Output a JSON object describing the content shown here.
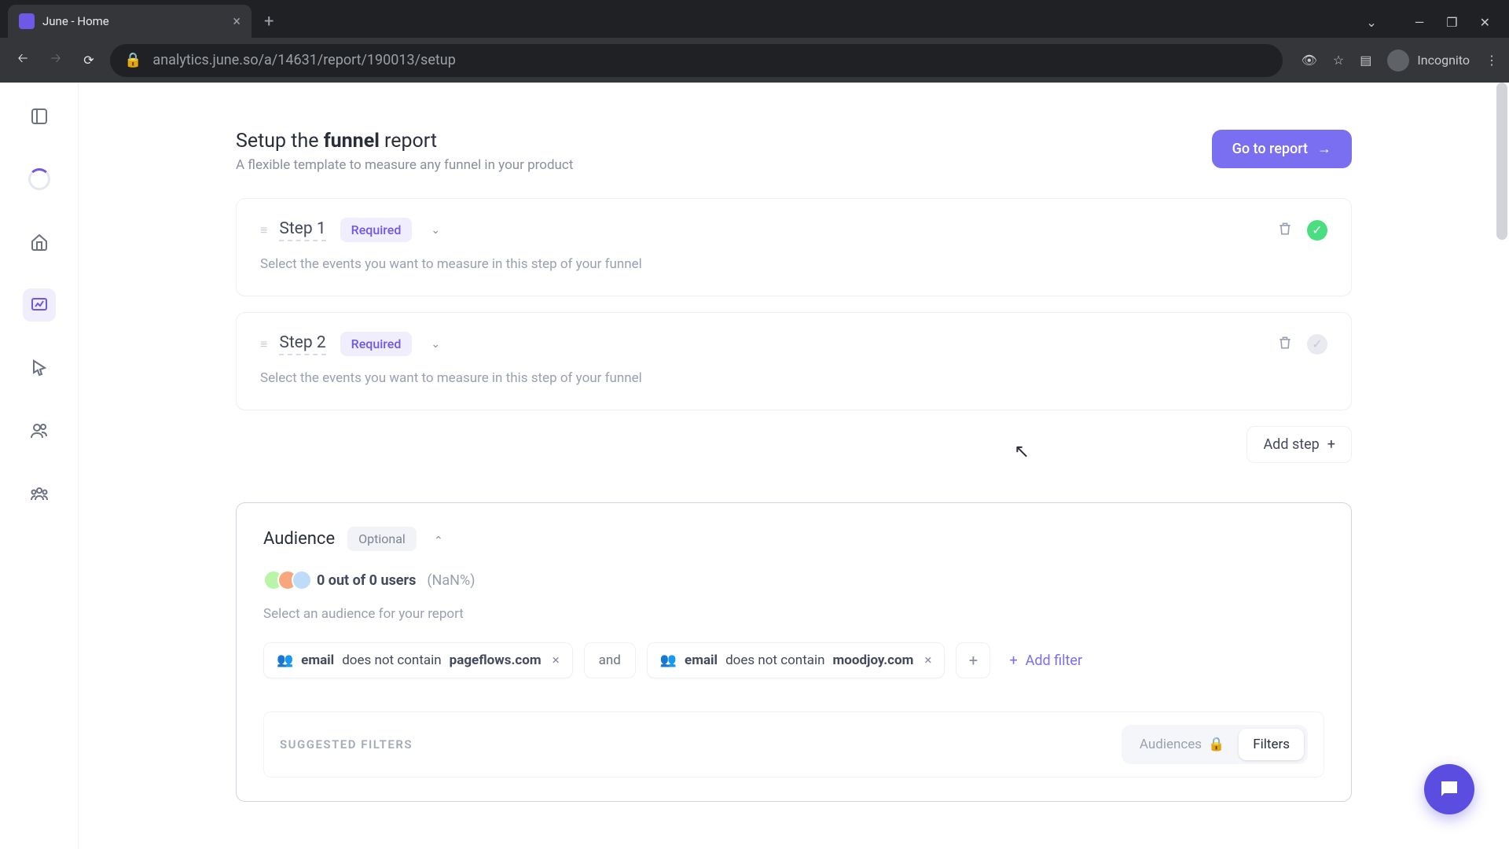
{
  "browser": {
    "tab_title": "June - Home",
    "url": "analytics.june.so/a/14631/report/190013/setup",
    "incognito_label": "Incognito"
  },
  "header": {
    "title_prefix": "Setup the ",
    "title_bold": "funnel",
    "title_suffix": " report",
    "subtitle": "A flexible template to measure any funnel in your product",
    "go_button": "Go to report"
  },
  "steps": [
    {
      "name": "Step 1",
      "badge": "Required",
      "desc": "Select the events you want to measure in this step of your funnel",
      "status": "done"
    },
    {
      "name": "Step 2",
      "badge": "Required",
      "desc": "Select the events you want to measure in this step of your funnel",
      "status": "pending"
    }
  ],
  "add_step_label": "Add step",
  "audience": {
    "title": "Audience",
    "badge": "Optional",
    "stats_bold": "0 out of 0 users",
    "stats_pct": "(NaN%)",
    "desc": "Select an audience for your report",
    "filters": [
      {
        "field": "email",
        "op": "does not contain",
        "value": "pageflows.com"
      },
      {
        "field": "email",
        "op": "does not contain",
        "value": "moodjoy.com"
      }
    ],
    "and_label": "and",
    "add_filter_label": "Add filter",
    "suggested_label": "SUGGESTED FILTERS",
    "seg_audiences": "Audiences",
    "seg_filters": "Filters"
  }
}
